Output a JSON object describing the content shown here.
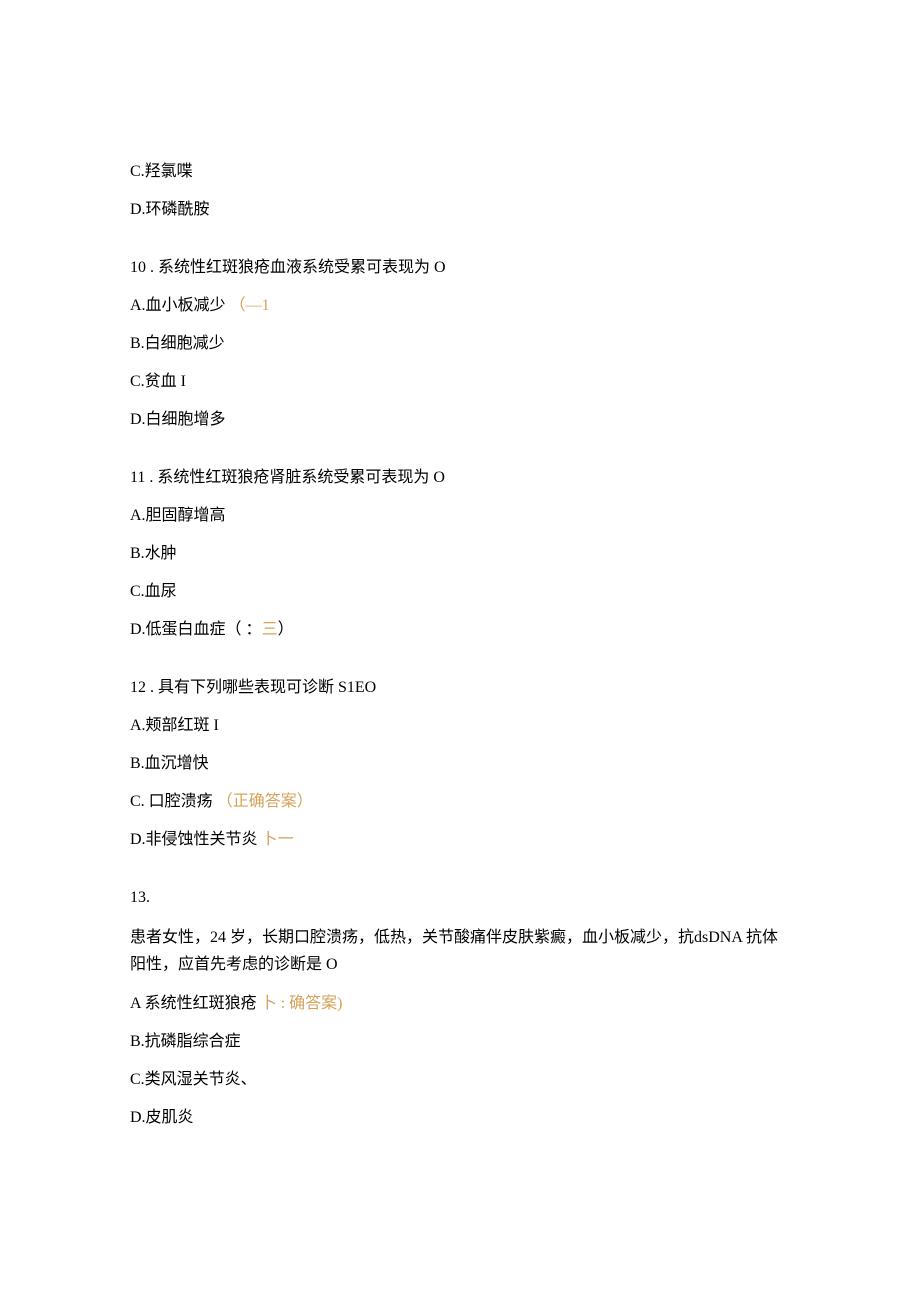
{
  "prelude": {
    "c": "C.羟氯喋",
    "d": "D.环磷酰胺"
  },
  "q10": {
    "title": "10  . 系统性红斑狼疮血液系统受累可表现为 O",
    "a_text": "A.血小板减少",
    "a_annot": "（—1",
    "b": "B.白细胞减少",
    "c": "C.贫血 I",
    "d": "D.白细胞增多"
  },
  "q11": {
    "title": "11  .  系统性红斑狼疮肾脏系统受累可表现为 O",
    "a": "A.胆固醇增高",
    "b": "B.水肿",
    "c": "C.血尿",
    "d_text": "D.低蛋白血症（       ：",
    "d_annot": "三",
    "d_close": "）"
  },
  "q12": {
    "title": "12  .  具有下列哪些表现可诊断 S1EO",
    "a": "A.颊部红斑 I",
    "b": "B.血沉增快",
    "c_text": "C.    口腔溃疡",
    "c_annot": "（正确答案）",
    "d_text": "D.非侵蚀性关节炎",
    "d_annot": " 卜一"
  },
  "q13": {
    "title": "13.",
    "stem": "患者女性，24 岁，长期口腔溃疡，低热，关节酸痛伴皮肤紫癜，血小板减少，抗dsDNA 抗体阳性，应首先考虑的诊断是 O",
    "a_text": "A 系统性红斑狼疮",
    "a_annot": " 卜 : 确答案)",
    "b": "B.抗磷脂综合症",
    "c": "C.类风湿关节炎、",
    "d": "D.皮肌炎"
  }
}
